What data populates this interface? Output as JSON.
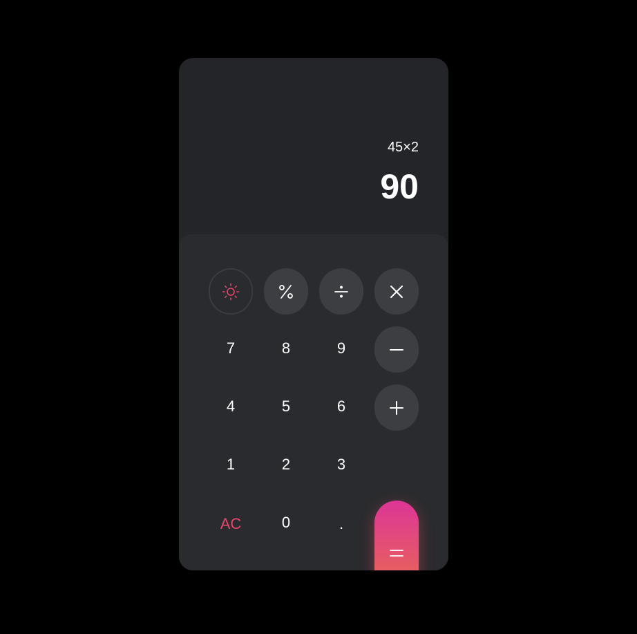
{
  "display": {
    "expression": "45×2",
    "result": "90"
  },
  "colors": {
    "background": "#000000",
    "card": "#242528",
    "keypad": "#2a2b2e",
    "operator_button": "#3d3e41",
    "accent": "#e5476d",
    "equals_gradient": [
      "#dd3596",
      "#ea7440"
    ]
  },
  "keys": {
    "theme_icon": "sun-icon",
    "percent_icon": "percent-icon",
    "divide_icon": "divide-icon",
    "multiply_icon": "multiply-icon",
    "minus_icon": "minus-icon",
    "plus_icon": "plus-icon",
    "equals_icon": "equals-icon",
    "seven": "7",
    "eight": "8",
    "nine": "9",
    "four": "4",
    "five": "5",
    "six": "6",
    "one": "1",
    "two": "2",
    "three": "3",
    "all_clear": "AC",
    "zero": "0",
    "decimal": "."
  }
}
